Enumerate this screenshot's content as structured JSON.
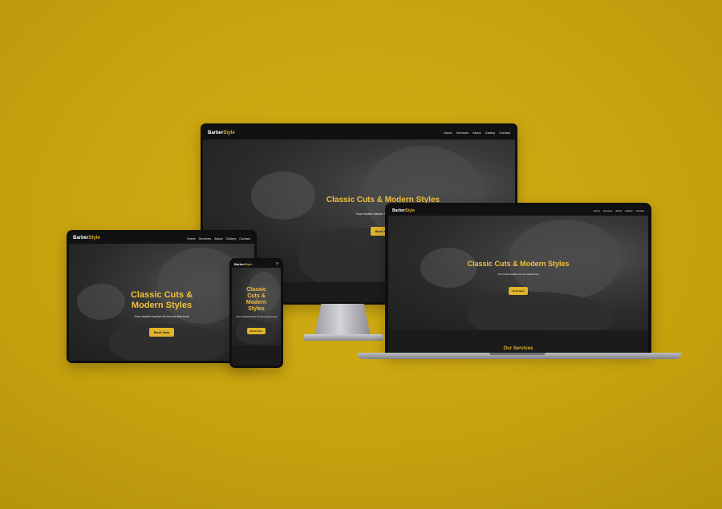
{
  "site": {
    "brand_main": "Barber",
    "brand_accent": "Style",
    "nav": [
      "Home",
      "Services",
      "About",
      "Gallery",
      "Contact"
    ],
    "hero_title_line1": "Classic Cuts & ",
    "hero_title_line2": "Modern Styles",
    "hero_title_full": "Classic Cuts & Modern Styles",
    "phone_title_l1": "Classic",
    "phone_title_l2": "Cuts &",
    "phone_title_l3": "Modern",
    "phone_title_l4": "Styles",
    "hero_subtitle": "Your trusted barber for the perfect look",
    "cta_label": "Book Now",
    "services_heading": "Our Services"
  },
  "colors": {
    "background": "#c9a40f",
    "accent": "#e0b32b",
    "nav_bg": "#111111"
  }
}
